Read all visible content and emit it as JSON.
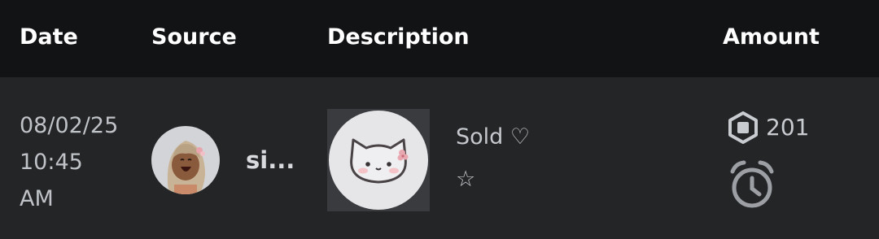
{
  "header": {
    "date": "Date",
    "source": "Source",
    "description": "Description",
    "amount": "Amount"
  },
  "row": {
    "date_lines": [
      "08/02/25",
      "10:45",
      "AM"
    ],
    "source_name": "si...",
    "description_line1": "Sold ♡",
    "description_line2": "☆",
    "amount": "201",
    "amount_icon": "robux-icon",
    "status_icon": "clock-icon"
  },
  "colors": {
    "header_bg": "#121315",
    "row_bg": "#232527",
    "text": "#c5c8cc"
  }
}
